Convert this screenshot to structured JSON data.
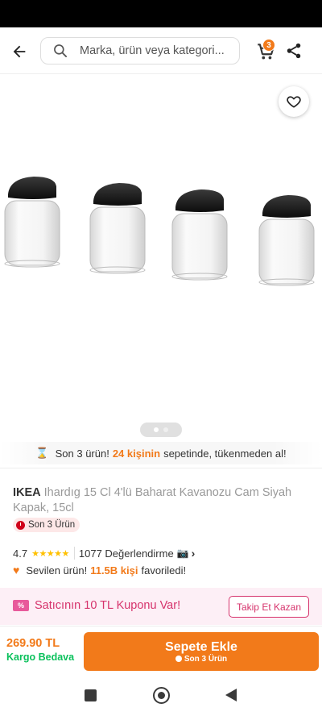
{
  "header": {
    "search_placeholder": "Marka, ürün veya kategori...",
    "cart_count": "3"
  },
  "gallery": {
    "image_count": 2,
    "active_index": 0
  },
  "stock_banner": {
    "icon": "hourglass-icon",
    "prefix": "Son 3 ürün!",
    "highlight": "24 kişinin",
    "suffix": "sepetinde, tükenmeden al!"
  },
  "product": {
    "brand": "IKEA",
    "name": "Ihardıg 15 Cl 4'lü Baharat Kavanozu Cam Siyah Kapak, 15cl",
    "stock_badge": "Son 3 Ürün",
    "rating": "4.7",
    "stars": "★★★★★",
    "reviews": "1077 Değerlendirme",
    "favorites": {
      "prefix": "Sevilen ürün!",
      "count": "11.5B kişi",
      "suffix": "favoriledi!"
    }
  },
  "coupon": {
    "text": "Satıcının 10 TL Kuponu Var!",
    "button": "Takip Et Kazan"
  },
  "purchase": {
    "price": "269.90 TL",
    "shipping": "Kargo Bedava",
    "button_main": "Sepete Ekle",
    "button_sub": "Son 3 Ürün"
  },
  "colors": {
    "accent": "#f27a1a",
    "success": "#0bc15c",
    "coupon": "#d6336c"
  }
}
